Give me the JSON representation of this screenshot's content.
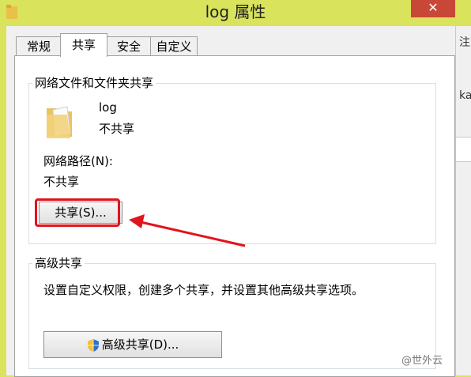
{
  "window": {
    "title": "log 属性",
    "close_glyph": "✕"
  },
  "tabs": [
    {
      "label": "常规",
      "active": false
    },
    {
      "label": "共享",
      "active": true
    },
    {
      "label": "安全",
      "active": false
    },
    {
      "label": "自定义",
      "active": false
    }
  ],
  "network_sharing": {
    "group_title": "网络文件和文件夹共享",
    "item_name": "log",
    "item_status": "不共享",
    "path_label": "网络路径(N):",
    "path_value": "不共享",
    "share_button": "共享(S)..."
  },
  "advanced_sharing": {
    "group_title": "高级共享",
    "description": "设置自定义权限，创建多个共享，并设置其他高级共享选项。",
    "button": "高级共享(D)..."
  },
  "background_window_fragments": [
    "注",
    "ka"
  ],
  "watermark": "@世外云",
  "colors": {
    "highlight": "#e1131d",
    "title_bar": "#d9e35c",
    "close": "#c94736"
  }
}
